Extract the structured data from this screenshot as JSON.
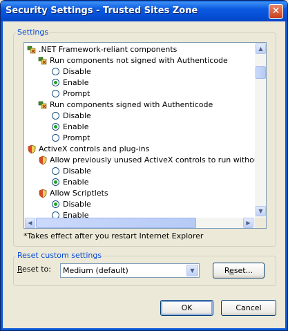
{
  "window": {
    "title": "Security Settings - Trusted Sites Zone",
    "close_glyph": "✕"
  },
  "settings_group": {
    "label": "Settings"
  },
  "tree": [
    {
      "type": "category",
      "icon": "dotnet-settings-icon",
      "label": ".NET Framework-reliant components"
    },
    {
      "type": "setting",
      "icon": "dotnet-settings-icon",
      "label": "Run components not signed with Authenticode"
    },
    {
      "type": "radio",
      "label": "Disable",
      "checked": false
    },
    {
      "type": "radio",
      "label": "Enable",
      "checked": true
    },
    {
      "type": "radio",
      "label": "Prompt",
      "checked": false
    },
    {
      "type": "setting",
      "icon": "dotnet-settings-icon",
      "label": "Run components signed with Authenticode"
    },
    {
      "type": "radio",
      "label": "Disable",
      "checked": false
    },
    {
      "type": "radio",
      "label": "Enable",
      "checked": true
    },
    {
      "type": "radio",
      "label": "Prompt",
      "checked": false
    },
    {
      "type": "category",
      "icon": "shield-icon",
      "label": "ActiveX controls and plug-ins"
    },
    {
      "type": "setting",
      "icon": "shield-icon",
      "label": "Allow previously unused ActiveX controls to run without prom"
    },
    {
      "type": "radio",
      "label": "Disable",
      "checked": false
    },
    {
      "type": "radio",
      "label": "Enable",
      "checked": true
    },
    {
      "type": "setting",
      "icon": "shield-icon",
      "label": "Allow Scriptlets"
    },
    {
      "type": "radio",
      "label": "Disable",
      "checked": true
    },
    {
      "type": "radio",
      "label": "Enable",
      "checked": false
    }
  ],
  "scroll": {
    "up": "▲",
    "down": "▼",
    "left": "◀",
    "right": "▶"
  },
  "note": "*Takes effect after you restart Internet Explorer",
  "reset_group": {
    "label": "Reset custom settings",
    "reset_to_label": "Reset to:",
    "reset_to_value": "Medium (default)",
    "reset_button": "Reset...",
    "dropdown_glyph": "▼"
  },
  "footer": {
    "ok": "OK",
    "cancel": "Cancel"
  },
  "colors": {
    "title_bar": "#0a5fd8",
    "group_label": "#0046d5",
    "dialog_bg": "#ece9d8"
  }
}
